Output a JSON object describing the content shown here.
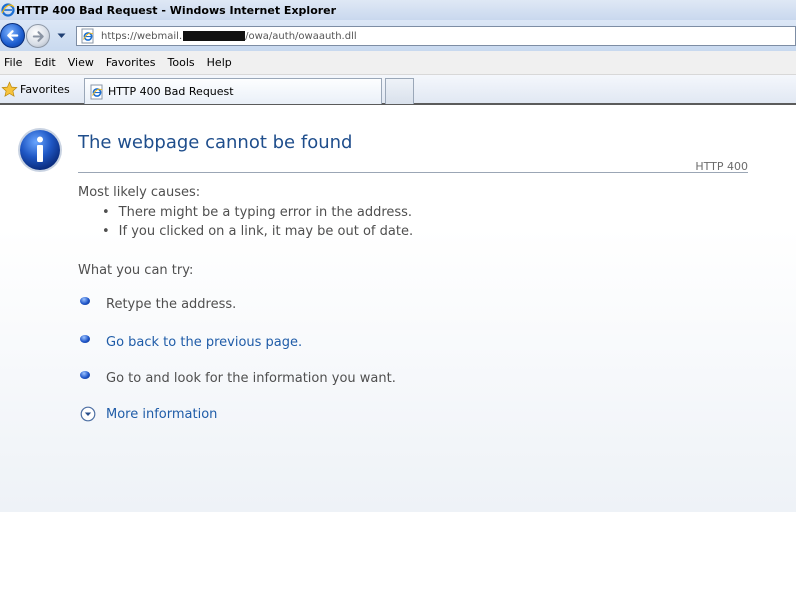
{
  "window": {
    "title": "HTTP 400 Bad Request - Windows Internet Explorer"
  },
  "address_bar": {
    "url_prefix": "https://webmail.",
    "url_suffix": "/owa/auth/owaauth.dll"
  },
  "menu": {
    "items": [
      "File",
      "Edit",
      "View",
      "Favorites",
      "Tools",
      "Help"
    ]
  },
  "favorites_bar": {
    "favorites_label": "Favorites",
    "tab_title": "HTTP 400 Bad Request"
  },
  "error_page": {
    "title": "The webpage cannot be found",
    "http_code": "HTTP 400",
    "causes_heading": "Most likely causes:",
    "causes": [
      "There might be a typing error in the address.",
      "If you clicked on a link, it may be out of date."
    ],
    "try_heading": "What you can try:",
    "try_items": [
      "Retype the address.",
      "Go back to the previous page.",
      "Go to  and look for the information you want."
    ],
    "more_info": "More information"
  },
  "colors": {
    "title_blue": "#1f4e8c",
    "link_blue": "#1f5ca8",
    "body_text": "#4f4f4f"
  }
}
